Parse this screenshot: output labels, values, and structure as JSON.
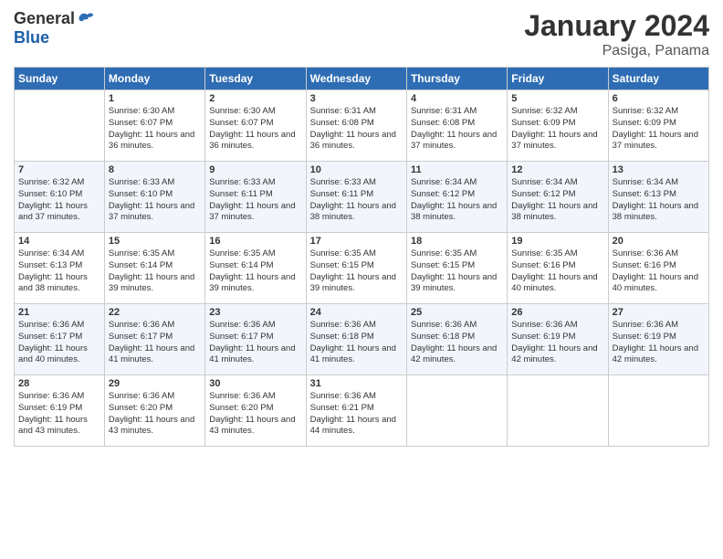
{
  "header": {
    "logo_general": "General",
    "logo_blue": "Blue",
    "title": "January 2024",
    "subtitle": "Pasiga, Panama"
  },
  "days_of_week": [
    "Sunday",
    "Monday",
    "Tuesday",
    "Wednesday",
    "Thursday",
    "Friday",
    "Saturday"
  ],
  "weeks": [
    [
      {
        "day": "",
        "info": ""
      },
      {
        "day": "1",
        "info": "Sunrise: 6:30 AM\nSunset: 6:07 PM\nDaylight: 11 hours and 36 minutes."
      },
      {
        "day": "2",
        "info": "Sunrise: 6:30 AM\nSunset: 6:07 PM\nDaylight: 11 hours and 36 minutes."
      },
      {
        "day": "3",
        "info": "Sunrise: 6:31 AM\nSunset: 6:08 PM\nDaylight: 11 hours and 36 minutes."
      },
      {
        "day": "4",
        "info": "Sunrise: 6:31 AM\nSunset: 6:08 PM\nDaylight: 11 hours and 37 minutes."
      },
      {
        "day": "5",
        "info": "Sunrise: 6:32 AM\nSunset: 6:09 PM\nDaylight: 11 hours and 37 minutes."
      },
      {
        "day": "6",
        "info": "Sunrise: 6:32 AM\nSunset: 6:09 PM\nDaylight: 11 hours and 37 minutes."
      }
    ],
    [
      {
        "day": "7",
        "info": "Sunrise: 6:32 AM\nSunset: 6:10 PM\nDaylight: 11 hours and 37 minutes."
      },
      {
        "day": "8",
        "info": "Sunrise: 6:33 AM\nSunset: 6:10 PM\nDaylight: 11 hours and 37 minutes."
      },
      {
        "day": "9",
        "info": "Sunrise: 6:33 AM\nSunset: 6:11 PM\nDaylight: 11 hours and 37 minutes."
      },
      {
        "day": "10",
        "info": "Sunrise: 6:33 AM\nSunset: 6:11 PM\nDaylight: 11 hours and 38 minutes."
      },
      {
        "day": "11",
        "info": "Sunrise: 6:34 AM\nSunset: 6:12 PM\nDaylight: 11 hours and 38 minutes."
      },
      {
        "day": "12",
        "info": "Sunrise: 6:34 AM\nSunset: 6:12 PM\nDaylight: 11 hours and 38 minutes."
      },
      {
        "day": "13",
        "info": "Sunrise: 6:34 AM\nSunset: 6:13 PM\nDaylight: 11 hours and 38 minutes."
      }
    ],
    [
      {
        "day": "14",
        "info": "Sunrise: 6:34 AM\nSunset: 6:13 PM\nDaylight: 11 hours and 38 minutes."
      },
      {
        "day": "15",
        "info": "Sunrise: 6:35 AM\nSunset: 6:14 PM\nDaylight: 11 hours and 39 minutes."
      },
      {
        "day": "16",
        "info": "Sunrise: 6:35 AM\nSunset: 6:14 PM\nDaylight: 11 hours and 39 minutes."
      },
      {
        "day": "17",
        "info": "Sunrise: 6:35 AM\nSunset: 6:15 PM\nDaylight: 11 hours and 39 minutes."
      },
      {
        "day": "18",
        "info": "Sunrise: 6:35 AM\nSunset: 6:15 PM\nDaylight: 11 hours and 39 minutes."
      },
      {
        "day": "19",
        "info": "Sunrise: 6:35 AM\nSunset: 6:16 PM\nDaylight: 11 hours and 40 minutes."
      },
      {
        "day": "20",
        "info": "Sunrise: 6:36 AM\nSunset: 6:16 PM\nDaylight: 11 hours and 40 minutes."
      }
    ],
    [
      {
        "day": "21",
        "info": "Sunrise: 6:36 AM\nSunset: 6:17 PM\nDaylight: 11 hours and 40 minutes."
      },
      {
        "day": "22",
        "info": "Sunrise: 6:36 AM\nSunset: 6:17 PM\nDaylight: 11 hours and 41 minutes."
      },
      {
        "day": "23",
        "info": "Sunrise: 6:36 AM\nSunset: 6:17 PM\nDaylight: 11 hours and 41 minutes."
      },
      {
        "day": "24",
        "info": "Sunrise: 6:36 AM\nSunset: 6:18 PM\nDaylight: 11 hours and 41 minutes."
      },
      {
        "day": "25",
        "info": "Sunrise: 6:36 AM\nSunset: 6:18 PM\nDaylight: 11 hours and 42 minutes."
      },
      {
        "day": "26",
        "info": "Sunrise: 6:36 AM\nSunset: 6:19 PM\nDaylight: 11 hours and 42 minutes."
      },
      {
        "day": "27",
        "info": "Sunrise: 6:36 AM\nSunset: 6:19 PM\nDaylight: 11 hours and 42 minutes."
      }
    ],
    [
      {
        "day": "28",
        "info": "Sunrise: 6:36 AM\nSunset: 6:19 PM\nDaylight: 11 hours and 43 minutes."
      },
      {
        "day": "29",
        "info": "Sunrise: 6:36 AM\nSunset: 6:20 PM\nDaylight: 11 hours and 43 minutes."
      },
      {
        "day": "30",
        "info": "Sunrise: 6:36 AM\nSunset: 6:20 PM\nDaylight: 11 hours and 43 minutes."
      },
      {
        "day": "31",
        "info": "Sunrise: 6:36 AM\nSunset: 6:21 PM\nDaylight: 11 hours and 44 minutes."
      },
      {
        "day": "",
        "info": ""
      },
      {
        "day": "",
        "info": ""
      },
      {
        "day": "",
        "info": ""
      }
    ]
  ]
}
